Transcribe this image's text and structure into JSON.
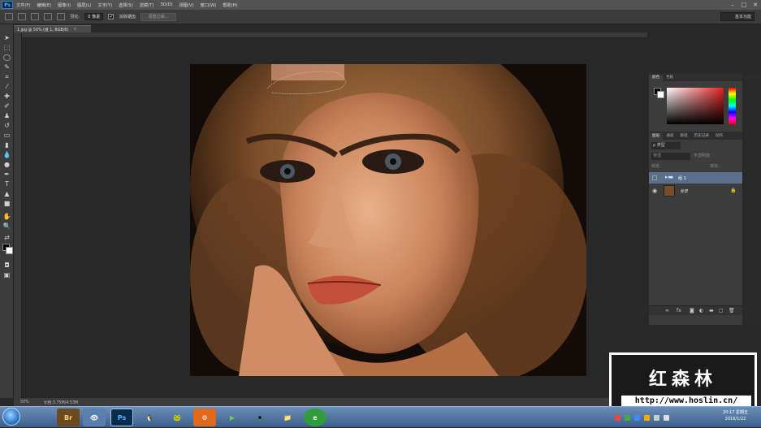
{
  "menubar": {
    "logo": "Ps",
    "items": [
      "文件(F)",
      "编辑(E)",
      "图像(I)",
      "图层(L)",
      "文字(Y)",
      "选择(S)",
      "滤镜(T)",
      "3D(D)",
      "视图(V)",
      "窗口(W)",
      "帮助(H)"
    ],
    "controls": [
      "–",
      "□",
      "✕"
    ]
  },
  "optionsbar": {
    "feather_label": "羽化:",
    "feather_value": "0 像素",
    "antialias_label": "消除锯齿",
    "antialias_checked": "✓",
    "refine_button": "调整边缘...",
    "workspace": "基本功能"
  },
  "document": {
    "tab_label": "1.jpg @ 50% (组 1, RGB/8)",
    "close": "×"
  },
  "statusbar": {
    "zoom": "50%",
    "doc_info": "文档:3.75M/4.53M"
  },
  "panels": {
    "color_tabs": [
      "颜色",
      "色板"
    ],
    "layers_tabs": [
      "图层",
      "通道",
      "路径",
      "历史记录",
      "动作"
    ],
    "kind_label": "ρ 类型",
    "blend_mode": "穿透",
    "opacity_label": "不透明度:",
    "lock_label": "锁定:",
    "fill_label": "填充:",
    "layers": [
      {
        "name": "组 1",
        "type": "group"
      },
      {
        "name": "背景",
        "type": "image"
      }
    ]
  },
  "taskbar": {
    "apps": [
      "Br",
      "👁",
      "Ps",
      "🐧",
      "🐸",
      "⚙",
      "▶",
      "⚫",
      "📁",
      "e"
    ],
    "clock_time": "20:17 星期五",
    "clock_date": "2016/1/22"
  },
  "watermark": {
    "title": "红森林",
    "url": "http://www.hoslin.cn/"
  },
  "colors": {
    "ps_blue": "#4fb3ff",
    "panel_bg": "#3c3c3c",
    "selected_layer": "#5a6f8c"
  }
}
